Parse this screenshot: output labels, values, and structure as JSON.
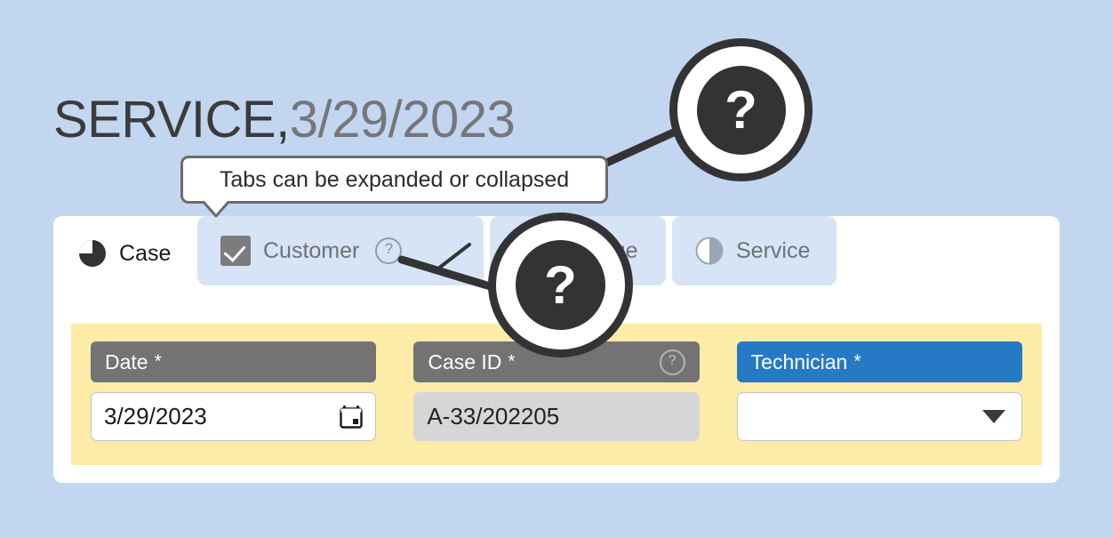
{
  "theme": {
    "page_background": "#c2d6f0",
    "card_background": "#ffffff",
    "form_panel_background": "#fceca8",
    "accent_blue": "#2679c5",
    "header_gray": "#737373",
    "badge_dark": "#333335"
  },
  "header": {
    "title_main": "SERVICE,",
    "title_date": "3/29/2023"
  },
  "tooltip": {
    "text": "Tabs can be expanded or collapsed"
  },
  "badges": [
    {
      "name": "help-badge-tabs",
      "glyph": "?"
    },
    {
      "name": "help-badge-fields",
      "glyph": "?"
    }
  ],
  "tabs": [
    {
      "label": "Case",
      "icon": "pie-chart-icon",
      "active": true,
      "has_checkbox": false,
      "has_help": false
    },
    {
      "label": "Customer",
      "icon": "checkbox-checked-icon",
      "active": false,
      "has_checkbox": true,
      "has_help": true,
      "help_glyph": "?"
    },
    {
      "label": "Damage",
      "icon": "pie-chart-icon",
      "active": false,
      "has_checkbox": false,
      "has_help": false
    },
    {
      "label": "Service",
      "icon": "half-circle-icon",
      "active": false,
      "has_checkbox": false,
      "has_help": false
    }
  ],
  "form": {
    "required_marker": "*",
    "fields": [
      {
        "label": "Date",
        "required": true,
        "header_style": "gray",
        "has_help": false,
        "value": "3/29/2023",
        "control": "date",
        "icon": "calendar-icon",
        "readonly": false
      },
      {
        "label": "Case ID",
        "required": true,
        "header_style": "gray",
        "has_help": true,
        "help_glyph": "?",
        "value": "A-33/202205",
        "control": "text",
        "icon": "",
        "readonly": true
      },
      {
        "label": "Technician",
        "required": true,
        "header_style": "blue",
        "has_help": false,
        "value": "",
        "control": "select",
        "icon": "chevron-down-icon",
        "readonly": false
      }
    ]
  }
}
